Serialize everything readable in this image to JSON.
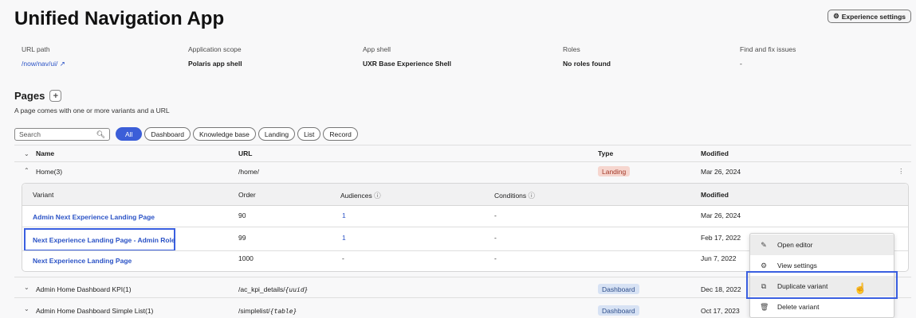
{
  "app": {
    "title": "Unified Navigation App",
    "settings_button": "Experience settings"
  },
  "meta": [
    {
      "label": "URL path",
      "value": "/now/nav/ui/",
      "is_link": true
    },
    {
      "label": "Application scope",
      "value": "Polaris app shell"
    },
    {
      "label": "App shell",
      "value": "UXR Base Experience Shell"
    },
    {
      "label": "Roles",
      "value": "No roles found"
    },
    {
      "label": "Find and fix issues",
      "value": "-"
    }
  ],
  "pages": {
    "title": "Pages",
    "description": "A page comes with one or more variants and a URL",
    "search_placeholder": "Search",
    "filters": [
      "All",
      "Dashboard",
      "Knowledge base",
      "Landing",
      "List",
      "Record"
    ],
    "columns": {
      "name": "Name",
      "url": "URL",
      "type": "Type",
      "modified": "Modified"
    },
    "rows": [
      {
        "name": "Home(3)",
        "url": "/home/",
        "type": "Landing",
        "modified": "Mar 26, 2024"
      },
      {
        "name": "Admin Home Dashboard KPI(1)",
        "url_prefix": "/ac_kpi_details/",
        "url_param": "{uuid}",
        "type": "Dashboard",
        "modified": "Dec 18, 2022"
      },
      {
        "name": "Admin Home Dashboard Simple List(1)",
        "url_prefix": "/simplelist/",
        "url_param": "{table}",
        "type": "Dashboard",
        "modified": "Oct 17, 2023"
      }
    ],
    "variants": {
      "columns": {
        "variant": "Variant",
        "order": "Order",
        "audiences": "Audiences",
        "conditions": "Conditions",
        "modified": "Modified"
      },
      "rows": [
        {
          "variant": "Admin Next Experience Landing Page",
          "order": "90",
          "audiences": "1",
          "conditions": "-",
          "modified": "Mar 26, 2024"
        },
        {
          "variant": "Next Experience Landing Page - Admin Role",
          "order": "99",
          "audiences": "1",
          "conditions": "-",
          "modified": "Feb 17, 2022"
        },
        {
          "variant": "Next Experience Landing Page",
          "order": "1000",
          "audiences": "-",
          "conditions": "-",
          "modified": "Jun 7, 2022"
        }
      ]
    }
  },
  "context_menu": {
    "items": [
      {
        "label": "Open editor",
        "icon": "pencil-icon"
      },
      {
        "label": "View settings",
        "icon": "gear-icon"
      },
      {
        "label": "Duplicate variant",
        "icon": "duplicate-icon"
      },
      {
        "label": "Delete variant",
        "icon": "trash-icon"
      }
    ]
  },
  "colors": {
    "accent": "#3b5ed8",
    "link": "#2b53c6",
    "highlight": "#3a5fe0",
    "landing_badge": "#f6d6cf",
    "dashboard_badge": "#d7e2f4"
  }
}
